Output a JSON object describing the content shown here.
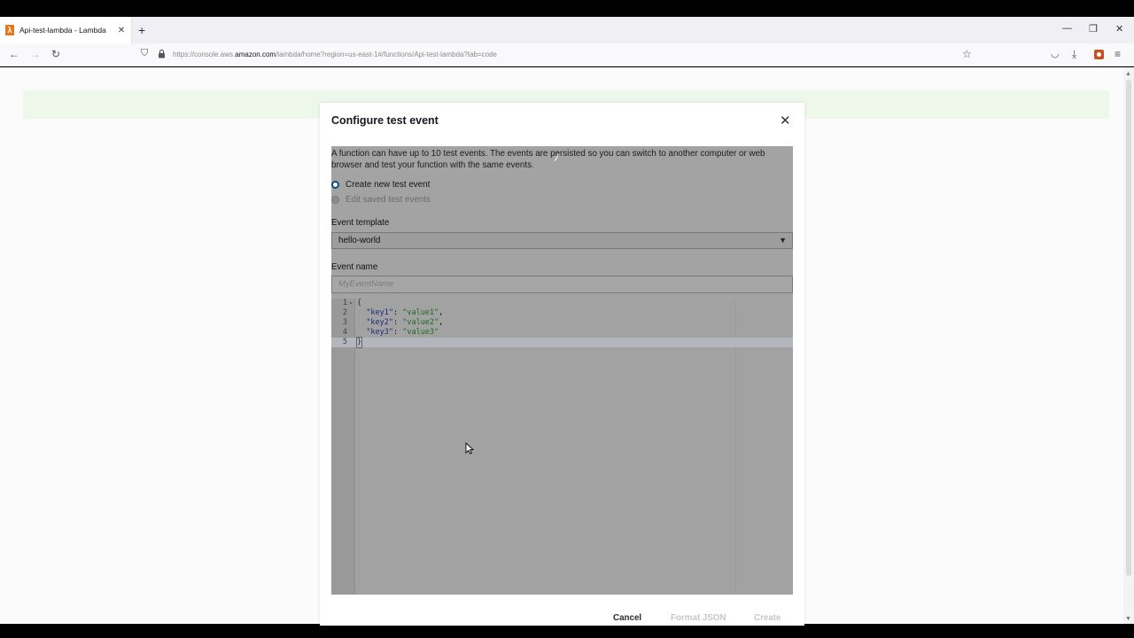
{
  "browser": {
    "tab_title": "Api-test-lambda - Lambda",
    "url_prefix": "https://console.aws.",
    "url_domain": "amazon.com",
    "url_path": "/lambda/home?region=us-east-1#/functions/Api-test-lambda?tab=code",
    "new_tab_icon": "+",
    "close_tab_icon": "✕"
  },
  "modal": {
    "title": "Configure test event",
    "description": "A function can have up to 10 test events. The events are persisted so you can switch to another computer or web browser and test your function with the same events.",
    "radio_create": "Create new test event",
    "radio_edit": "Edit saved test events",
    "event_template_label": "Event template",
    "event_template_value": "hello-world",
    "event_name_label": "Event name",
    "event_name_placeholder": "MyEventName",
    "code_lines": [
      {
        "num": "1",
        "text": "{"
      },
      {
        "num": "2",
        "key": "\"key1\"",
        "value": "\"value1\"",
        "trail": ","
      },
      {
        "num": "3",
        "key": "\"key2\"",
        "value": "\"value2\"",
        "trail": ","
      },
      {
        "num": "4",
        "key": "\"key3\"",
        "value": "\"value3\"",
        "trail": ""
      },
      {
        "num": "5",
        "text": "}"
      }
    ],
    "buttons": {
      "cancel": "Cancel",
      "format_json": "Format JSON",
      "create": "Create"
    }
  },
  "icons": {
    "back": "arrow-left-icon",
    "forward": "arrow-right-icon",
    "reload": "reload-icon",
    "shield": "shield-icon",
    "lock": "lock-icon",
    "star": "star-icon",
    "pocket": "pocket-icon",
    "download": "download-icon",
    "extension": "extension-icon",
    "menu": "menu-icon",
    "close": "close-icon"
  },
  "colors": {
    "radio_selected": "#0b4f82",
    "json_key": "#1f2a7a",
    "json_string": "#1f6b1f",
    "favicon": "#e8761f"
  }
}
